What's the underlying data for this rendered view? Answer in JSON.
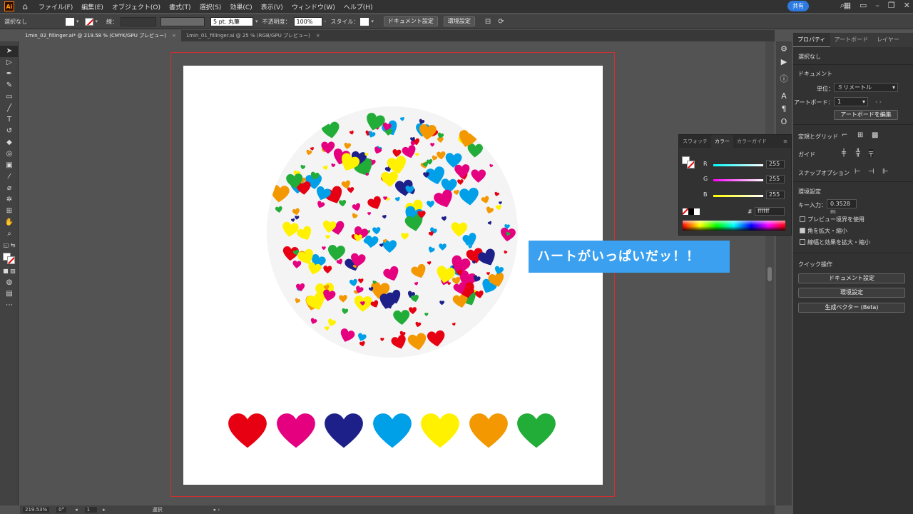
{
  "app": {
    "logo": "Ai",
    "menu": [
      "ファイル(F)",
      "編集(E)",
      "オブジェクト(O)",
      "書式(T)",
      "選択(S)",
      "効果(C)",
      "表示(V)",
      "ウィンドウ(W)",
      "ヘルプ(H)"
    ],
    "share_label": "共有"
  },
  "control": {
    "selection_label": "選択なし",
    "stroke_label": "線：",
    "brush_label": "5 pt. 丸筆",
    "opacity_label": "不透明度：",
    "opacity_value": "100%",
    "style_label": "スタイル：",
    "doc_setup_label": "ドキュメント設定",
    "prefs_label": "環境設定"
  },
  "tabs": [
    {
      "label": "1min_02_fillinger.ai* @ 219.58 % (CMYK/GPU プレビュー)",
      "active": true
    },
    {
      "label": "1min_01_fillinger.ai @ 25 % (RGB/GPU プレビュー)",
      "active": false
    }
  ],
  "tab_close": "×",
  "tools": [
    "selection-tool",
    "direct-selection-tool",
    "pen-tool",
    "curvature-tool",
    "rectangle-tool",
    "paintbrush-tool",
    "type-tool",
    "rotate-tool",
    "eraser-tool",
    "shape-builder-tool",
    "gradient-tool",
    "eyedropper-tool",
    "blend-tool",
    "symbol-sprayer-tool",
    "artboard-tool",
    "hand-tool",
    "zoom-tool"
  ],
  "canvas": {
    "callout_text": "ハートがいっぱいだッ！！",
    "heart_row_colors": [
      "#e60012",
      "#e4007f",
      "#1d2088",
      "#00a0e9",
      "#fff100",
      "#f39800",
      "#22ac38"
    ],
    "heart_palette": [
      "#e60012",
      "#e4007f",
      "#1d2088",
      "#00a0e9",
      "#fff100",
      "#f39800",
      "#22ac38"
    ]
  },
  "status": {
    "zoom": "219.53%",
    "rotation": "0°",
    "artboard_num": "1",
    "mode": "選択"
  },
  "color_panel": {
    "tabs": [
      "スウォッチ",
      "カラー",
      "カラーガイド"
    ],
    "r_label": "R",
    "g_label": "G",
    "b_label": "B",
    "r": "255",
    "g": "255",
    "b": "255",
    "hex_label": "#",
    "hex": "ffffff"
  },
  "properties": {
    "tabs": [
      "プロパティ",
      "アートボード",
      "レイヤー"
    ],
    "selection": "選択なし",
    "document_heading": "ドキュメント",
    "unit_label": "単位：",
    "unit_value": "ミリメートル",
    "artboard_label": "アートボード：",
    "artboard_value": "1",
    "edit_artboard": "アートボードを編集",
    "rulers_grid": "定規とグリッド",
    "guides": "ガイド",
    "snap": "スナップオプション",
    "prefs_heading": "環境設定",
    "key_input_label": "キー入力：",
    "key_input_value": "0.3528 m",
    "preview_bounds": "プレビュー境界を使用",
    "scale_corners": "角を拡大・縮小",
    "scale_strokes": "線幅と効果を拡大・縮小",
    "quick_actions": "クイック操作",
    "qa_doc_setup": "ドキュメント設定",
    "qa_prefs": "環境設定",
    "qa_gen_vector": "生成ベクター (Beta)"
  }
}
